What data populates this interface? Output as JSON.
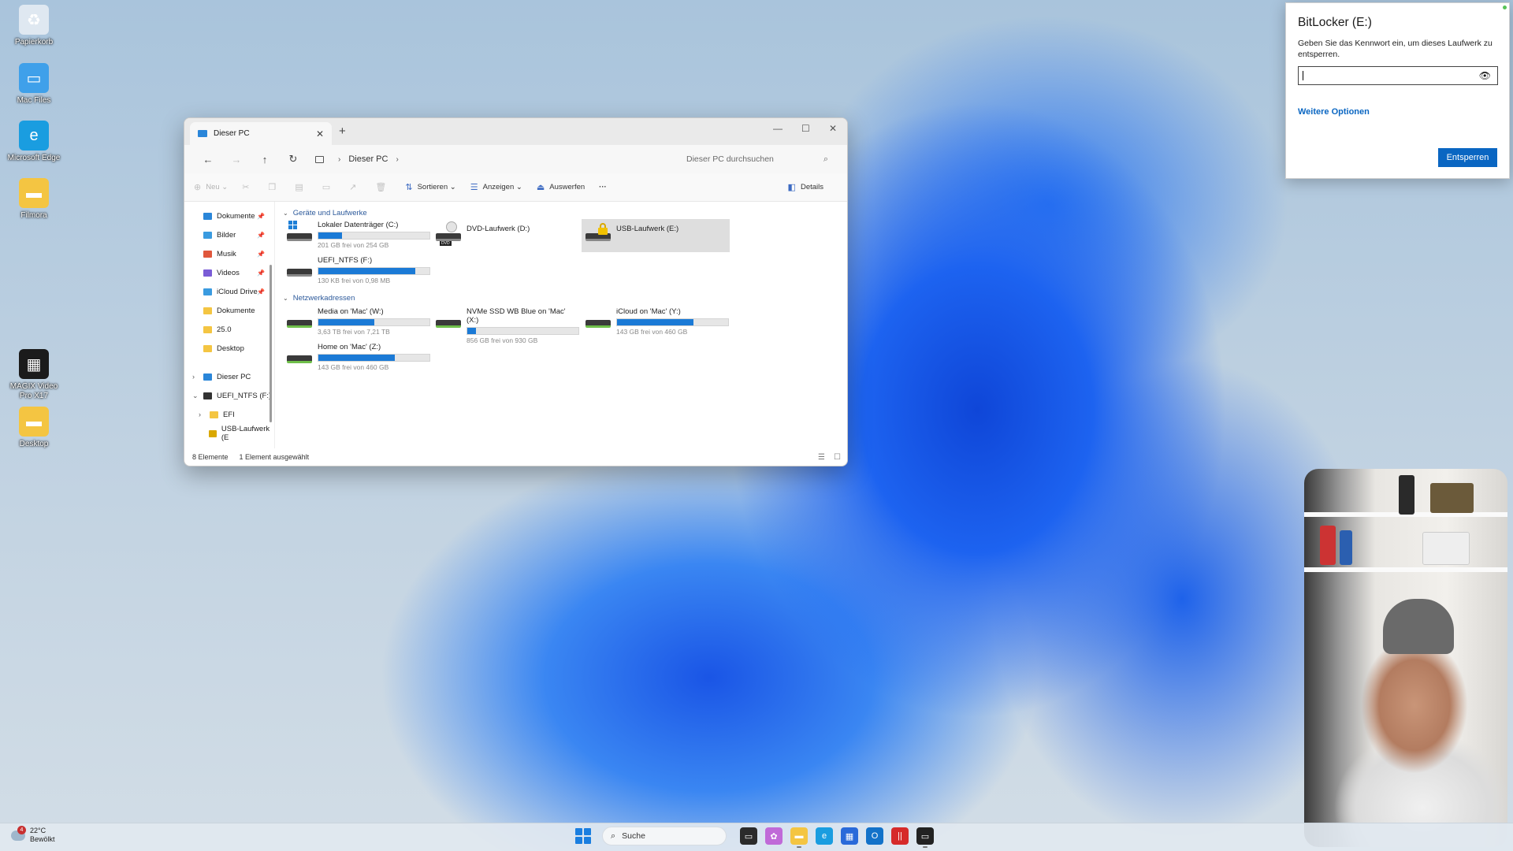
{
  "desktop": {
    "icons": [
      {
        "label": "Papierkorb",
        "icon": "recycle-bin-icon",
        "color": "#dfe8f1",
        "glyph": "♻"
      },
      {
        "label": "Mac Files",
        "icon": "mac-folder-icon",
        "color": "#3fa0ea",
        "glyph": "▭"
      },
      {
        "label": "Microsoft Edge",
        "icon": "edge-icon",
        "color": "#1a9de0",
        "glyph": "e"
      },
      {
        "label": "Filmora",
        "icon": "folder-icon",
        "color": "#f4c542",
        "glyph": "▬"
      },
      {
        "label": "MAGIX Video Pro X17",
        "icon": "magix-video-icon",
        "color": "#1b1b1b",
        "glyph": "▦"
      },
      {
        "label": "Desktop",
        "icon": "folder-icon",
        "color": "#f4c542",
        "glyph": "▬"
      }
    ]
  },
  "explorer": {
    "tab_title": "Dieser PC",
    "breadcrumb": "Dieser PC",
    "search_placeholder": "Dieser PC durchsuchen",
    "commands": {
      "new": "Neu",
      "sort": "Sortieren",
      "view": "Anzeigen",
      "eject": "Auswerfen",
      "more": "···",
      "details": "Details"
    },
    "sidebar": {
      "quick": [
        {
          "label": "Dokumente",
          "color": "#2a86d9",
          "pinned": true
        },
        {
          "label": "Bilder",
          "color": "#3a9be0",
          "pinned": true
        },
        {
          "label": "Musik",
          "color": "#e0573c",
          "pinned": true
        },
        {
          "label": "Videos",
          "color": "#7a5cd6",
          "pinned": true
        },
        {
          "label": "iCloud Drive",
          "color": "#3a9be0",
          "pinned": true
        },
        {
          "label": "Dokumente",
          "color": "#f4c542",
          "pinned": false
        },
        {
          "label": "25.0",
          "color": "#f4c542",
          "pinned": false
        },
        {
          "label": "Desktop",
          "color": "#f4c542",
          "pinned": false
        }
      ],
      "tree": [
        {
          "label": "Dieser PC",
          "arrow": "›",
          "color": "#2a86d9"
        },
        {
          "label": "UEFI_NTFS (F:)",
          "arrow": "⌄",
          "color": "#333333"
        },
        {
          "label": "EFI",
          "arrow": "›",
          "color": "#f4c542"
        },
        {
          "label": "USB-Laufwerk (E",
          "arrow": "",
          "color": "#d9a800"
        }
      ]
    },
    "sections": {
      "devices": "Geräte und Laufwerke",
      "network": "Netzwerkadressen"
    },
    "drives": {
      "c": {
        "name": "Lokaler Datenträger (C:)",
        "free": "201 GB frei von 254 GB",
        "used_fraction": 0.21
      },
      "d": {
        "name": "DVD-Laufwerk (D:)"
      },
      "e": {
        "name": "USB-Laufwerk (E:)"
      },
      "f": {
        "name": "UEFI_NTFS (F:)",
        "free": "130 KB frei von 0,98 MB",
        "used_fraction": 0.87
      },
      "w": {
        "name": "Media on 'Mac' (W:)",
        "free": "3,63 TB frei von 7,21 TB",
        "used_fraction": 0.5
      },
      "x": {
        "name": "NVMe SSD WB Blue on 'Mac' (X:)",
        "free": "856 GB frei von 930 GB",
        "used_fraction": 0.08
      },
      "y": {
        "name": "iCloud on 'Mac' (Y:)",
        "free": "143 GB frei von 460 GB",
        "used_fraction": 0.69
      },
      "z": {
        "name": "Home on 'Mac' (Z:)",
        "free": "143 GB frei von 460 GB",
        "used_fraction": 0.69
      }
    },
    "status": {
      "count": "8 Elemente",
      "selected": "1 Element ausgewählt"
    }
  },
  "bitlocker": {
    "title": "BitLocker (E:)",
    "description": "Geben Sie das Kennwort ein, um dieses Laufwerk zu entsperren.",
    "more_options": "Weitere Optionen",
    "unlock_button": "Entsperren"
  },
  "taskbar": {
    "weather_temp": "22°C",
    "weather_desc": "Bewölkt",
    "notification_count": "4",
    "search_label": "Suche",
    "apps": [
      {
        "icon": "task-view-icon",
        "color": "#2b2b2b",
        "glyph": "▭"
      },
      {
        "icon": "copilot-icon",
        "color": "#c06ad8",
        "glyph": "✿"
      },
      {
        "icon": "file-explorer-icon",
        "color": "#f4c542",
        "glyph": "▬"
      },
      {
        "icon": "edge-icon",
        "color": "#1a9de0",
        "glyph": "e"
      },
      {
        "icon": "store-icon",
        "color": "#2a6ad9",
        "glyph": "▦"
      },
      {
        "icon": "outlook-icon",
        "color": "#1372c9",
        "glyph": "O"
      },
      {
        "icon": "parallels-icon",
        "color": "#d62a2a",
        "glyph": "||"
      },
      {
        "icon": "terminal-icon",
        "color": "#222222",
        "glyph": "▭"
      }
    ]
  }
}
